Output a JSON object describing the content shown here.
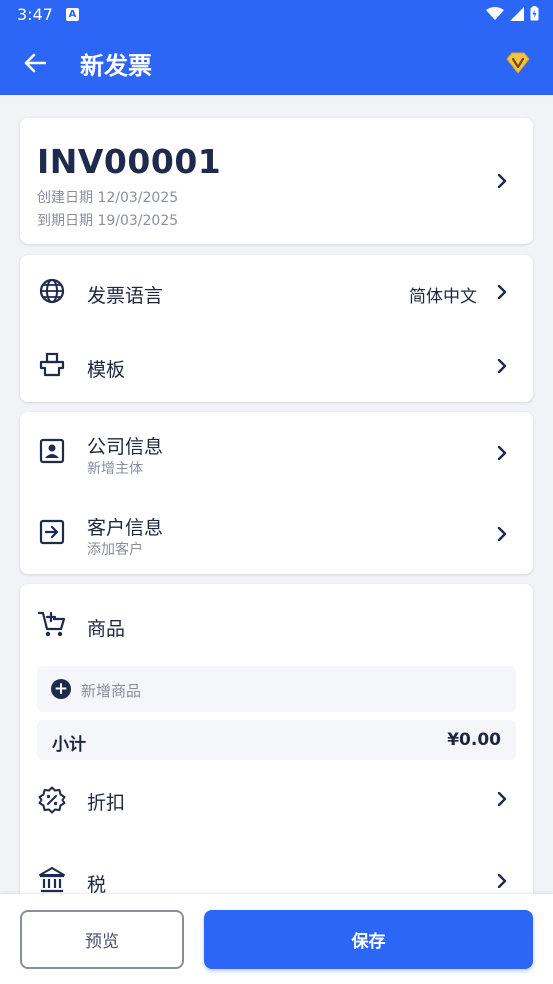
{
  "status_bar": {
    "time": "3:47",
    "notification_badge": "A"
  },
  "toolbar": {
    "title": "新发票",
    "back_icon": "arrow-left-icon",
    "vip_icon": "diamond-v-icon"
  },
  "invoice": {
    "number": "INV00001",
    "created": "创建日期 12/03/2025",
    "due": "到期日期 19/03/2025"
  },
  "settings": {
    "language_label": "发票语言",
    "language_value": "简体中文",
    "template_label": "模板"
  },
  "parties": {
    "company_label": "公司信息",
    "company_sub": "新增主体",
    "client_label": "客户信息",
    "client_sub": "添加客户"
  },
  "items": {
    "section_label": "商品",
    "add_label": "新增商品",
    "subtotal_label": "小计",
    "subtotal_value": "¥0.00",
    "discount_label": "折扣",
    "tax_label": "税"
  },
  "actions": {
    "preview_label": "预览",
    "save_label": "保存"
  },
  "colors": {
    "accent": "#2b66f6",
    "text_dark": "#1f2a4d",
    "muted": "#8a8fa0"
  }
}
